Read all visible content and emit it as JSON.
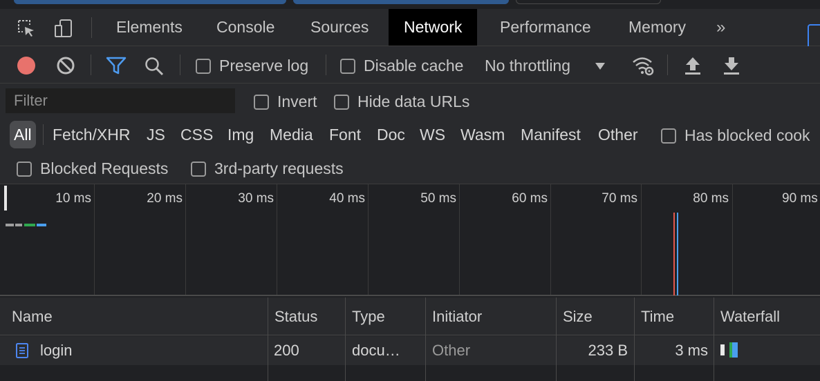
{
  "tabs": {
    "items": [
      "Elements",
      "Console",
      "Sources",
      "Network",
      "Performance",
      "Memory"
    ],
    "active": "Network",
    "more": "»"
  },
  "toolbar": {
    "preserve_log": "Preserve log",
    "disable_cache": "Disable cache",
    "throttling": "No throttling"
  },
  "filter": {
    "placeholder": "Filter",
    "invert": "Invert",
    "hide_data_urls": "Hide data URLs"
  },
  "types": {
    "all": "All",
    "items": [
      "Fetch/XHR",
      "JS",
      "CSS",
      "Img",
      "Media",
      "Font",
      "Doc",
      "WS",
      "Wasm",
      "Manifest",
      "Other"
    ],
    "has_blocked": "Has blocked cook"
  },
  "blocked": {
    "blocked_requests": "Blocked Requests",
    "third_party": "3rd-party requests"
  },
  "overview": {
    "ticks": [
      "10 ms",
      "20 ms",
      "30 ms",
      "40 ms",
      "50 ms",
      "60 ms",
      "70 ms",
      "80 ms",
      "90 ms"
    ]
  },
  "table": {
    "columns": [
      "Name",
      "Status",
      "Type",
      "Initiator",
      "Size",
      "Time",
      "Waterfall"
    ],
    "rows": [
      {
        "name": "login",
        "status": "200",
        "type": "docu…",
        "initiator": "Other",
        "size": "233 B",
        "time": "3 ms"
      }
    ]
  },
  "colors": {
    "record": "#e8726c",
    "accent": "#3d83f3",
    "marker_red": "#e3584e",
    "marker_blue": "#4a9eed"
  }
}
